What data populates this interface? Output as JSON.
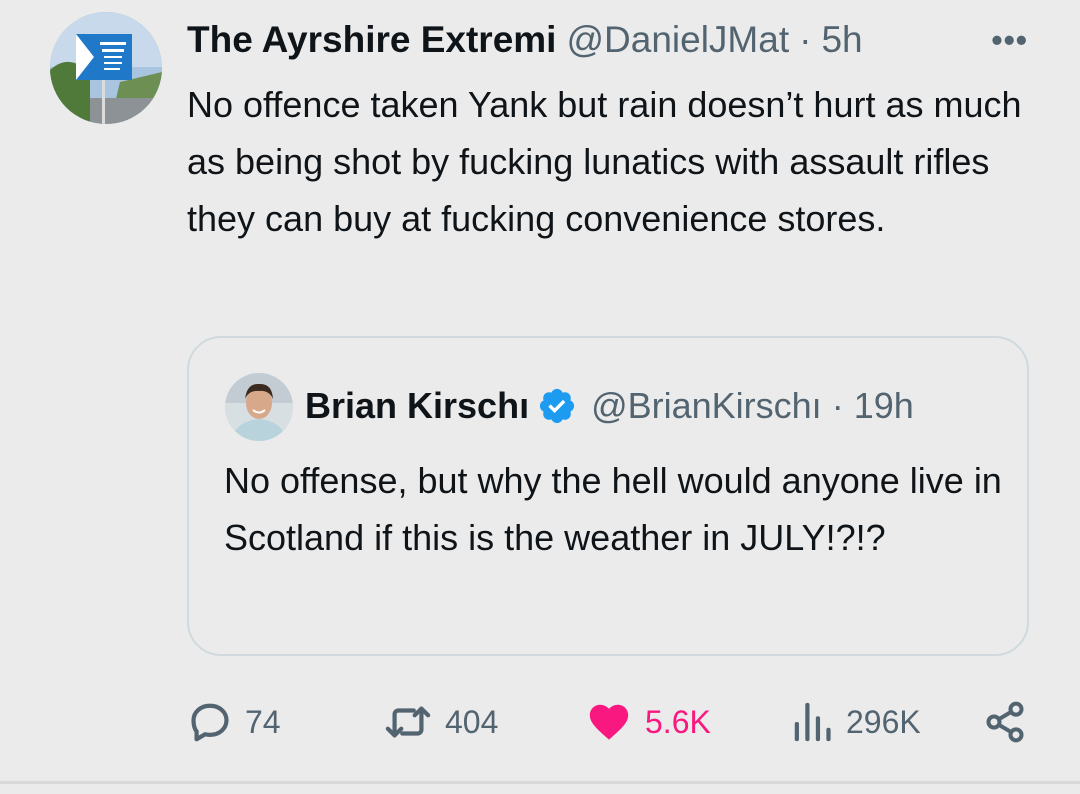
{
  "tweet": {
    "author_name": "The Ayrshire Extremi",
    "author_handle": "@DanielJMat",
    "separator": "·",
    "time": "5h",
    "more_label": "•••",
    "text": "No offence taken Yank but rain doesn’t hurt as much as being shot by fucking lunatics with assault rifles they can buy at fucking convenience stores."
  },
  "quote": {
    "author_name": "Brian Kirschı",
    "verified_icon": "verified-badge-icon",
    "author_handle": "@BrianKirschı",
    "separator": "·",
    "time": "19h",
    "text": "No offense, but why the hell would anyone live in Scotland if this is the weather in JULY!?!?"
  },
  "actions": {
    "replies": "74",
    "retweets": "404",
    "likes": "5.6K",
    "views": "296K"
  },
  "colors": {
    "background": "#ebebeb",
    "text_primary": "#0f1419",
    "text_secondary": "#536471",
    "like": "#f91880",
    "verified": "#1d9bf0",
    "card_border": "#cfd9de"
  }
}
